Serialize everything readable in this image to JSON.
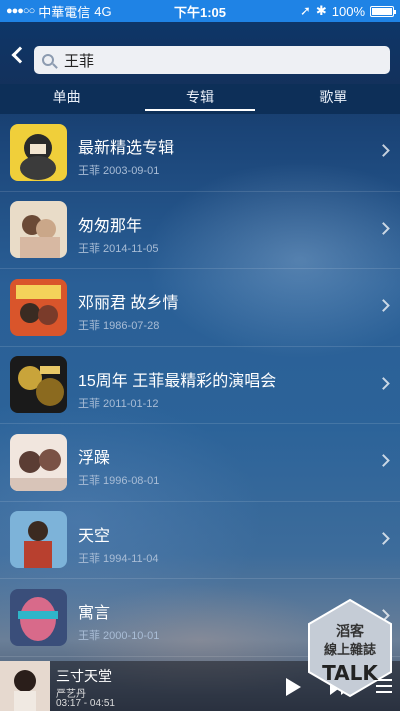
{
  "status": {
    "carrier": "中華電信",
    "network": "4G",
    "time": "下午1:05",
    "battery": "100%",
    "signal": "●●●○○"
  },
  "header": {
    "back_icon": "chevron-left-icon",
    "search_value": "王菲",
    "search_icon": "search-icon"
  },
  "tabs": [
    {
      "label": "单曲"
    },
    {
      "label": "专辑"
    },
    {
      "label": "歌單"
    }
  ],
  "albums": [
    {
      "title": "最新精选专辑",
      "meta": "王菲 2003-09-01"
    },
    {
      "title": "匆匆那年",
      "meta": "王菲 2014-11-05"
    },
    {
      "title": "邓丽君 故乡情",
      "meta": "王菲 1986-07-28"
    },
    {
      "title": "15周年  王菲最精彩的演唱会",
      "meta": "王菲 2011-01-12"
    },
    {
      "title": "浮躁",
      "meta": "王菲 1996-08-01"
    },
    {
      "title": "天空",
      "meta": "王菲 1994-11-04"
    },
    {
      "title": "寓言",
      "meta": "王菲 2000-10-01"
    }
  ],
  "player": {
    "song": "三寸天堂",
    "artist": "严艺丹",
    "time": "03:17 - 04:51",
    "play_icon": "play-icon",
    "next_icon": "fast-forward-icon",
    "menu_icon": "menu-icon"
  },
  "watermark": {
    "line1": "滔客",
    "line2": "線上雜誌",
    "line3": "TALK"
  },
  "colors": {
    "statusbar": "#1f83e5",
    "header": "#0e3668"
  }
}
